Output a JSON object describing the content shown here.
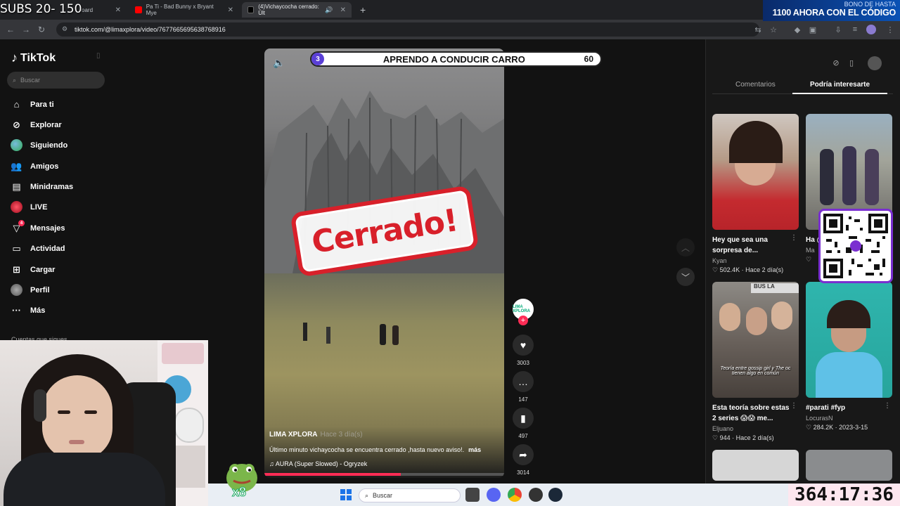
{
  "stream": {
    "subs": "SUBS 20- 150",
    "bono_line1": "BONO DE HASTA",
    "bono_line2": "1100 AHORA CON EL CÓDIGO",
    "timer": "364:17:36",
    "emote_count": "x8"
  },
  "browser": {
    "tabs": [
      {
        "label": "oard"
      },
      {
        "label": "Pa Ti - Bad Bunny x Bryant Mye"
      },
      {
        "label": "(4)Vichaycocha cerrado: Últ"
      }
    ],
    "url": "tiktok.com/@limaxplora/video/7677665695638768916"
  },
  "sidebar": {
    "logo": "TikTok",
    "search_placeholder": "Buscar",
    "items": [
      {
        "label": "Para ti",
        "icon": "home-icon"
      },
      {
        "label": "Explorar",
        "icon": "compass-icon"
      },
      {
        "label": "Siguiendo",
        "icon": "following-avatar-icon"
      },
      {
        "label": "Amigos",
        "icon": "friends-icon"
      },
      {
        "label": "Minidramas",
        "icon": "film-icon"
      },
      {
        "label": "LIVE",
        "icon": "live-icon"
      },
      {
        "label": "Mensajes",
        "icon": "messages-icon",
        "badge": "4"
      },
      {
        "label": "Actividad",
        "icon": "activity-icon"
      },
      {
        "label": "Cargar",
        "icon": "upload-icon"
      },
      {
        "label": "Perfil",
        "icon": "profile-icon"
      },
      {
        "label": "Más",
        "icon": "more-icon"
      }
    ],
    "following_label": "Cuentas que sigues"
  },
  "video": {
    "overlay_num": "3",
    "overlay_title": "APRENDO A CONDUCIR CARRO",
    "overlay_value": "60",
    "stamp": "Cerrado!",
    "author": "LIMA XPLORA",
    "time": "Hace 3 día(s)",
    "description": "Último minuto vichaycocha se encuentra cerrado ,hasta nuevo aviso!.",
    "more": "más",
    "music": "AURA (Super Slowed) - Ogryzek",
    "progress": 0.57,
    "avatar_text": "LIMA XPLORA",
    "likes": "3003",
    "comments": "147",
    "saves": "497",
    "shares": "3014"
  },
  "right": {
    "tab_comments": "Comentarios",
    "tab_suggested": "Podría interesarte",
    "cards": [
      {
        "title": "Hey que sea una sorpresa de...",
        "user": "Kyan",
        "meta": "♡ 502.4K · Hace 2 día(s)"
      },
      {
        "title": "Ha @l",
        "user": "Ma",
        "meta": "♡"
      },
      {
        "title": "Esta teoría sobre estas 2 series 😱😱 me...",
        "user": "Eljuano",
        "meta": "♡ 944 · Hace 2 día(s)"
      },
      {
        "title": "#parati #fyp",
        "user": "LocurasN",
        "meta": "♡ 284.2K · 2023-3-15"
      }
    ],
    "thumb3_caption": "Teoría entre gossip girl y The oc tienen algo en común",
    "thumb2_sign": "BUS LA"
  },
  "taskbar": {
    "search": "Buscar"
  }
}
